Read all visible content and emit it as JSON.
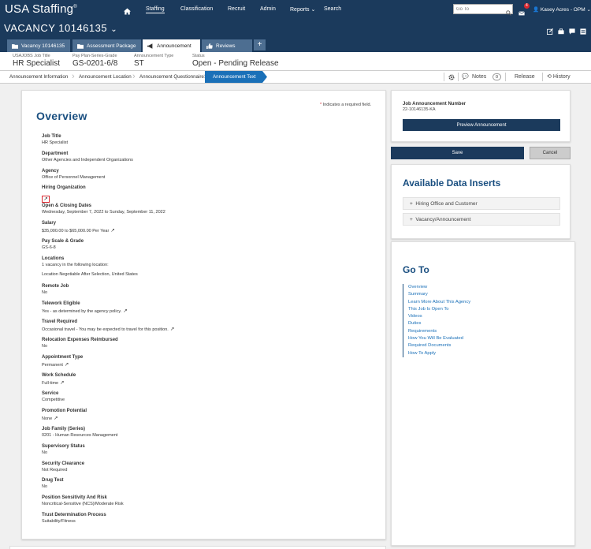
{
  "topnav": {
    "brand": "USA Staffing",
    "brand_mark": "®",
    "items": [
      "Staffing",
      "Classification",
      "Recruit",
      "Admin",
      "Reports",
      "Search"
    ],
    "goto_placeholder": "Go To",
    "mail_count": "4",
    "user": "Kasey Acres - OPM"
  },
  "vacancy": {
    "title": "VACANCY 10146135"
  },
  "tabs": [
    {
      "label": "Vacancy 10146135",
      "icon": "folder-icon"
    },
    {
      "label": "Assessment Package",
      "icon": "folder-icon"
    },
    {
      "label": "Announcement",
      "icon": "megaphone-icon"
    },
    {
      "label": "Reviews",
      "icon": "thumbs-up-icon"
    }
  ],
  "info": [
    {
      "label": "USAJOBS Job Title",
      "value": "HR Specialist"
    },
    {
      "label": "Pay Plan-Series-Grade",
      "value": "GS-0201-6/8"
    },
    {
      "label": "Announcement Type",
      "value": "ST"
    },
    {
      "label": "Status",
      "value": "Open - Pending Release"
    }
  ],
  "steps": [
    "Announcement Information",
    "Announcement Location",
    "Announcement Questionnaire",
    "Announcement Text"
  ],
  "tools": {
    "notes": "Notes",
    "notes_count": "0",
    "release": "Release",
    "history": "History"
  },
  "overview": {
    "title": "Overview",
    "required_note": "Indicates a required field.",
    "required_star": "*",
    "fields": [
      {
        "label": "Job Title",
        "value": "HR Specialist"
      },
      {
        "label": "Department",
        "value": "Other Agencies and Independent Organizations"
      },
      {
        "label": "Agency",
        "value": "Office of Personnel Management"
      },
      {
        "label": "Hiring Organization",
        "value": ""
      },
      {
        "label": "Open & Closing Dates",
        "value": "Wednesday, September 7, 2022 to Sunday, September 11, 2022"
      },
      {
        "label": "Salary",
        "value": "$35,000.00 to $65,000.00 Per Year"
      },
      {
        "label": "Pay Scale & Grade",
        "value": "GS-6-8"
      },
      {
        "label": "Locations",
        "value": "1 vacancy in the following location:",
        "value2": "Location Negotiable After Selection, United States"
      },
      {
        "label": "Remote Job",
        "value": "No"
      },
      {
        "label": "Telework Eligible",
        "value": "Yes - as determined by the agency policy."
      },
      {
        "label": "Travel Required",
        "value": "Occasional travel - You may be expected to travel for this position."
      },
      {
        "label": "Relocation Expenses Reimbursed",
        "value": "No"
      },
      {
        "label": "Appointment Type",
        "value": "Permanent"
      },
      {
        "label": "Work Schedule",
        "value": "Full-time"
      },
      {
        "label": "Service",
        "value": "Competitive"
      },
      {
        "label": "Promotion Potential",
        "value": "None"
      },
      {
        "label": "Job Family (Series)",
        "value": "0201 - Human Resources Management"
      },
      {
        "label": "Supervisory Status",
        "value": "No"
      },
      {
        "label": "Security Clearance",
        "value": "Not Required"
      },
      {
        "label": "Drug Test",
        "value": "No"
      },
      {
        "label": "Position Sensitivity And Risk",
        "value": "Noncritical-Sensitive (NCS)/Moderate Risk"
      },
      {
        "label": "Trust Determination Process",
        "value": "Suitability/Fitness"
      }
    ]
  },
  "sidebar": {
    "job_number_label": "Job Announcement Number",
    "job_number": "22-10146135-KA",
    "preview_label": "Preview Announcement",
    "save_label": "Save",
    "cancel_label": "Cancel",
    "data_inserts_title": "Available Data Inserts",
    "inserts": [
      "Hiring Office and Customer",
      "Vacancy/Announcement"
    ],
    "goto_title": "Go To",
    "goto_links": [
      "Overview",
      "Summary",
      "Learn More About This Agency",
      "This Job Is Open To",
      "Videos",
      "Duties",
      "Requirements",
      "How You Will Be Evaluated",
      "Required Documents",
      "How To Apply"
    ]
  }
}
